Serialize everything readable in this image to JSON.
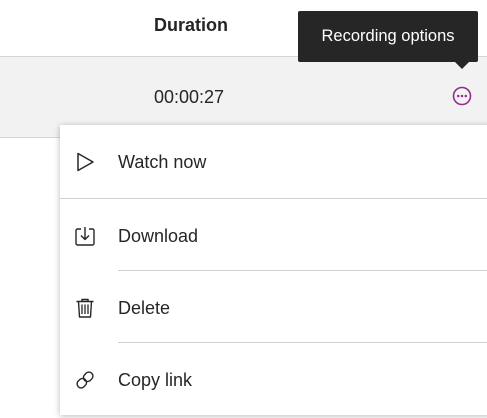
{
  "table": {
    "header": {
      "duration_label": "Duration"
    },
    "row": {
      "duration": "00:00:27"
    }
  },
  "tooltip": {
    "text": "Recording options"
  },
  "menu": {
    "items": [
      {
        "label": "Watch now",
        "icon": "play-icon"
      },
      {
        "label": "Download",
        "icon": "download-icon"
      },
      {
        "label": "Delete",
        "icon": "trash-icon"
      },
      {
        "label": "Copy link",
        "icon": "link-icon"
      }
    ]
  },
  "colors": {
    "accent": "#8f2e8f",
    "tooltip_bg": "#262626",
    "row_bg": "#f2f2f2",
    "text": "#262626"
  }
}
